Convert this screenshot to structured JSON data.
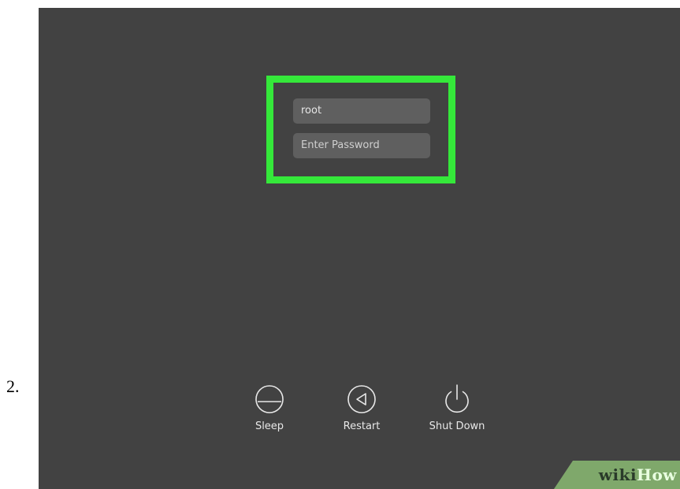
{
  "step": {
    "number": "2."
  },
  "login": {
    "username_value": "root",
    "password_placeholder": "Enter Password"
  },
  "power_buttons": [
    {
      "label": "Sleep",
      "icon": "sleep-icon"
    },
    {
      "label": "Restart",
      "icon": "restart-icon"
    },
    {
      "label": "Shut Down",
      "icon": "power-icon"
    }
  ],
  "colors": {
    "background": "#424242",
    "highlight": "#35e83a",
    "field": "#5f5f5f",
    "watermark": "#7fa86b"
  },
  "watermark": {
    "part1": "wiki",
    "part2": "How"
  }
}
